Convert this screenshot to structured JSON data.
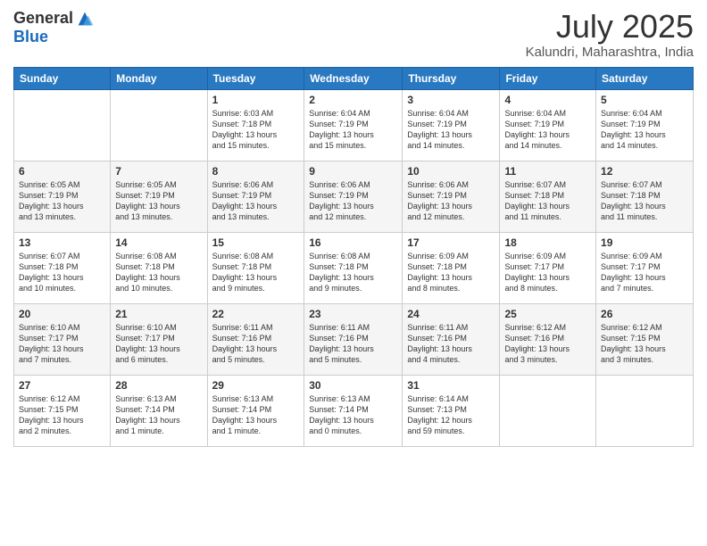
{
  "logo": {
    "general": "General",
    "blue": "Blue"
  },
  "title": {
    "month_year": "July 2025",
    "location": "Kalundri, Maharashtra, India"
  },
  "days_of_week": [
    "Sunday",
    "Monday",
    "Tuesday",
    "Wednesday",
    "Thursday",
    "Friday",
    "Saturday"
  ],
  "weeks": [
    [
      {
        "day": "",
        "info": ""
      },
      {
        "day": "",
        "info": ""
      },
      {
        "day": "1",
        "info": "Sunrise: 6:03 AM\nSunset: 7:18 PM\nDaylight: 13 hours\nand 15 minutes."
      },
      {
        "day": "2",
        "info": "Sunrise: 6:04 AM\nSunset: 7:19 PM\nDaylight: 13 hours\nand 15 minutes."
      },
      {
        "day": "3",
        "info": "Sunrise: 6:04 AM\nSunset: 7:19 PM\nDaylight: 13 hours\nand 14 minutes."
      },
      {
        "day": "4",
        "info": "Sunrise: 6:04 AM\nSunset: 7:19 PM\nDaylight: 13 hours\nand 14 minutes."
      },
      {
        "day": "5",
        "info": "Sunrise: 6:04 AM\nSunset: 7:19 PM\nDaylight: 13 hours\nand 14 minutes."
      }
    ],
    [
      {
        "day": "6",
        "info": "Sunrise: 6:05 AM\nSunset: 7:19 PM\nDaylight: 13 hours\nand 13 minutes."
      },
      {
        "day": "7",
        "info": "Sunrise: 6:05 AM\nSunset: 7:19 PM\nDaylight: 13 hours\nand 13 minutes."
      },
      {
        "day": "8",
        "info": "Sunrise: 6:06 AM\nSunset: 7:19 PM\nDaylight: 13 hours\nand 13 minutes."
      },
      {
        "day": "9",
        "info": "Sunrise: 6:06 AM\nSunset: 7:19 PM\nDaylight: 13 hours\nand 12 minutes."
      },
      {
        "day": "10",
        "info": "Sunrise: 6:06 AM\nSunset: 7:19 PM\nDaylight: 13 hours\nand 12 minutes."
      },
      {
        "day": "11",
        "info": "Sunrise: 6:07 AM\nSunset: 7:18 PM\nDaylight: 13 hours\nand 11 minutes."
      },
      {
        "day": "12",
        "info": "Sunrise: 6:07 AM\nSunset: 7:18 PM\nDaylight: 13 hours\nand 11 minutes."
      }
    ],
    [
      {
        "day": "13",
        "info": "Sunrise: 6:07 AM\nSunset: 7:18 PM\nDaylight: 13 hours\nand 10 minutes."
      },
      {
        "day": "14",
        "info": "Sunrise: 6:08 AM\nSunset: 7:18 PM\nDaylight: 13 hours\nand 10 minutes."
      },
      {
        "day": "15",
        "info": "Sunrise: 6:08 AM\nSunset: 7:18 PM\nDaylight: 13 hours\nand 9 minutes."
      },
      {
        "day": "16",
        "info": "Sunrise: 6:08 AM\nSunset: 7:18 PM\nDaylight: 13 hours\nand 9 minutes."
      },
      {
        "day": "17",
        "info": "Sunrise: 6:09 AM\nSunset: 7:18 PM\nDaylight: 13 hours\nand 8 minutes."
      },
      {
        "day": "18",
        "info": "Sunrise: 6:09 AM\nSunset: 7:17 PM\nDaylight: 13 hours\nand 8 minutes."
      },
      {
        "day": "19",
        "info": "Sunrise: 6:09 AM\nSunset: 7:17 PM\nDaylight: 13 hours\nand 7 minutes."
      }
    ],
    [
      {
        "day": "20",
        "info": "Sunrise: 6:10 AM\nSunset: 7:17 PM\nDaylight: 13 hours\nand 7 minutes."
      },
      {
        "day": "21",
        "info": "Sunrise: 6:10 AM\nSunset: 7:17 PM\nDaylight: 13 hours\nand 6 minutes."
      },
      {
        "day": "22",
        "info": "Sunrise: 6:11 AM\nSunset: 7:16 PM\nDaylight: 13 hours\nand 5 minutes."
      },
      {
        "day": "23",
        "info": "Sunrise: 6:11 AM\nSunset: 7:16 PM\nDaylight: 13 hours\nand 5 minutes."
      },
      {
        "day": "24",
        "info": "Sunrise: 6:11 AM\nSunset: 7:16 PM\nDaylight: 13 hours\nand 4 minutes."
      },
      {
        "day": "25",
        "info": "Sunrise: 6:12 AM\nSunset: 7:16 PM\nDaylight: 13 hours\nand 3 minutes."
      },
      {
        "day": "26",
        "info": "Sunrise: 6:12 AM\nSunset: 7:15 PM\nDaylight: 13 hours\nand 3 minutes."
      }
    ],
    [
      {
        "day": "27",
        "info": "Sunrise: 6:12 AM\nSunset: 7:15 PM\nDaylight: 13 hours\nand 2 minutes."
      },
      {
        "day": "28",
        "info": "Sunrise: 6:13 AM\nSunset: 7:14 PM\nDaylight: 13 hours\nand 1 minute."
      },
      {
        "day": "29",
        "info": "Sunrise: 6:13 AM\nSunset: 7:14 PM\nDaylight: 13 hours\nand 1 minute."
      },
      {
        "day": "30",
        "info": "Sunrise: 6:13 AM\nSunset: 7:14 PM\nDaylight: 13 hours\nand 0 minutes."
      },
      {
        "day": "31",
        "info": "Sunrise: 6:14 AM\nSunset: 7:13 PM\nDaylight: 12 hours\nand 59 minutes."
      },
      {
        "day": "",
        "info": ""
      },
      {
        "day": "",
        "info": ""
      }
    ]
  ]
}
